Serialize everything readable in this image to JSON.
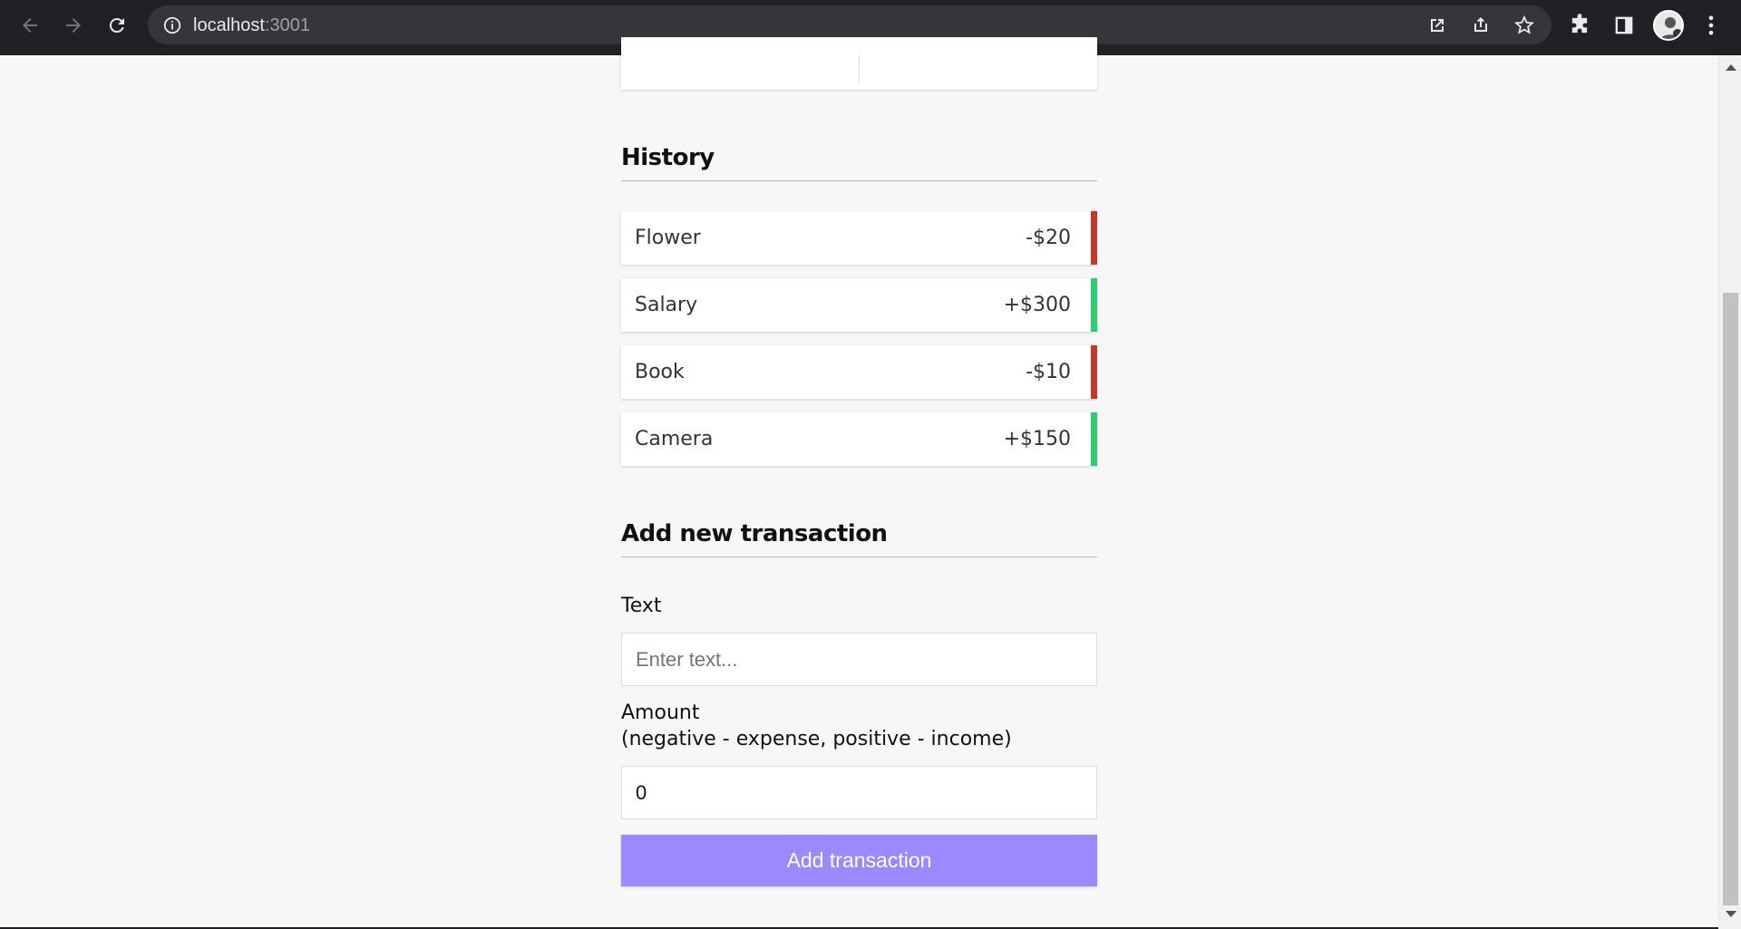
{
  "browser": {
    "url_host": "localhost",
    "url_port": ":3001"
  },
  "history": {
    "title": "History",
    "items": [
      {
        "text": "Flower",
        "amount": "-$20",
        "type": "minus"
      },
      {
        "text": "Salary",
        "amount": "+$300",
        "type": "plus"
      },
      {
        "text": "Book",
        "amount": "-$10",
        "type": "minus"
      },
      {
        "text": "Camera",
        "amount": "+$150",
        "type": "plus"
      }
    ]
  },
  "form": {
    "title": "Add new transaction",
    "text_label": "Text",
    "text_placeholder": "Enter text...",
    "amount_label_line1": "Amount",
    "amount_label_line2": "(negative - expense, positive - income)",
    "amount_value": "0",
    "submit_label": "Add transaction"
  },
  "colors": {
    "expense": "#c0392b",
    "income": "#2ecc71",
    "button": "#9c88ff"
  }
}
